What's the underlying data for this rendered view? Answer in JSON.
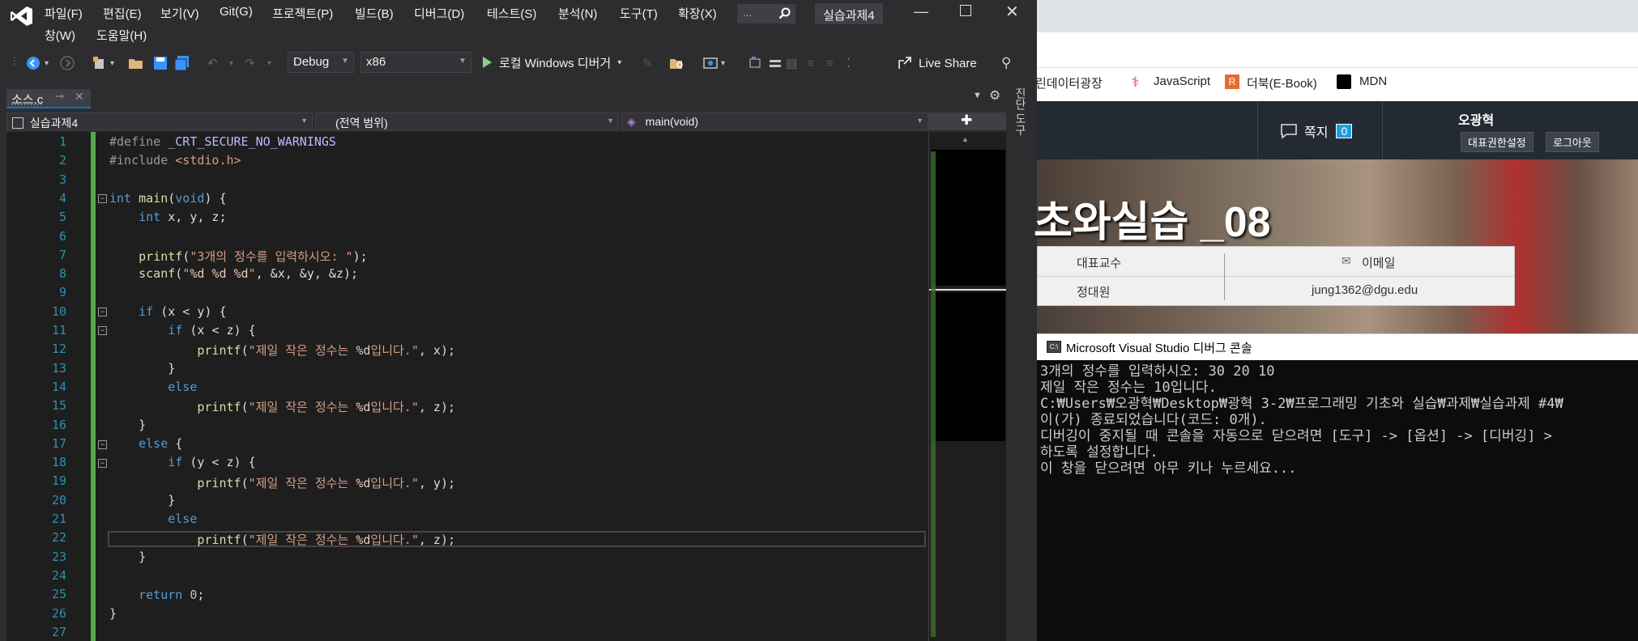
{
  "menu": {
    "items": [
      "파일(F)",
      "편집(E)",
      "보기(V)",
      "Git(G)",
      "프로젝트(P)",
      "빌드(B)",
      "디버그(D)",
      "테스트(S)",
      "분석(N)",
      "도구(T)",
      "확장(X)"
    ],
    "row2": [
      "창(W)",
      "도움말(H)"
    ],
    "search_placeholder": "...",
    "solution_name": "실습과제4"
  },
  "toolbar": {
    "config": "Debug",
    "platform": "x86",
    "run_label": "로컬 Windows 디버거",
    "live_share": "Live Share"
  },
  "tabs": {
    "file": "소스.c"
  },
  "navbar": {
    "project": "실습과제4",
    "scope": "(전역 범위)",
    "member": "main(void)"
  },
  "right_strip": {
    "label": "진단 도구"
  },
  "code": {
    "line_numbers": [
      "1",
      "2",
      "3",
      "4",
      "5",
      "6",
      "7",
      "8",
      "9",
      "10",
      "11",
      "12",
      "13",
      "14",
      "15",
      "16",
      "17",
      "18",
      "19",
      "20",
      "21",
      "22",
      "23",
      "24",
      "25",
      "26",
      "27"
    ]
  },
  "browser": {
    "bookmarks": [
      "린데이터광장",
      "JavaScript",
      "더북(E-Book)",
      "MDN"
    ],
    "mail_label": "쪽지",
    "mail_count": "0",
    "user_name": "오광혁",
    "btn_delegate": "대표권한설정",
    "btn_logout": "로그아웃",
    "course_title": "초와실습 _08",
    "prof_header": "대표교수",
    "email_header": "이메일",
    "prof_name": "정대원",
    "prof_email": "jung1362@dgu.edu"
  },
  "console": {
    "title": "Microsoft Visual Studio 디버그 콘솔",
    "lines": [
      "3개의 정수를 입력하시오: 30 20 10",
      "제일 작은 정수는 10입니다.",
      "C:₩Users₩오광혁₩Desktop₩광혁 3-2₩프로그래밍 기초와 실습₩과제₩실습과제 #4₩",
      "이(가) 종료되었습니다(코드: 0개).",
      "디버깅이 중지될 때 콘솔을 자동으로 닫으려면 [도구] -> [옵션] -> [디버깅] >",
      "하도록 설정합니다.",
      "이 창을 닫으려면 아무 키나 누르세요..."
    ]
  },
  "colors": {
    "accent": "#007acc",
    "gutter_green": "#57a64a",
    "badge": "#1ba1e2"
  }
}
